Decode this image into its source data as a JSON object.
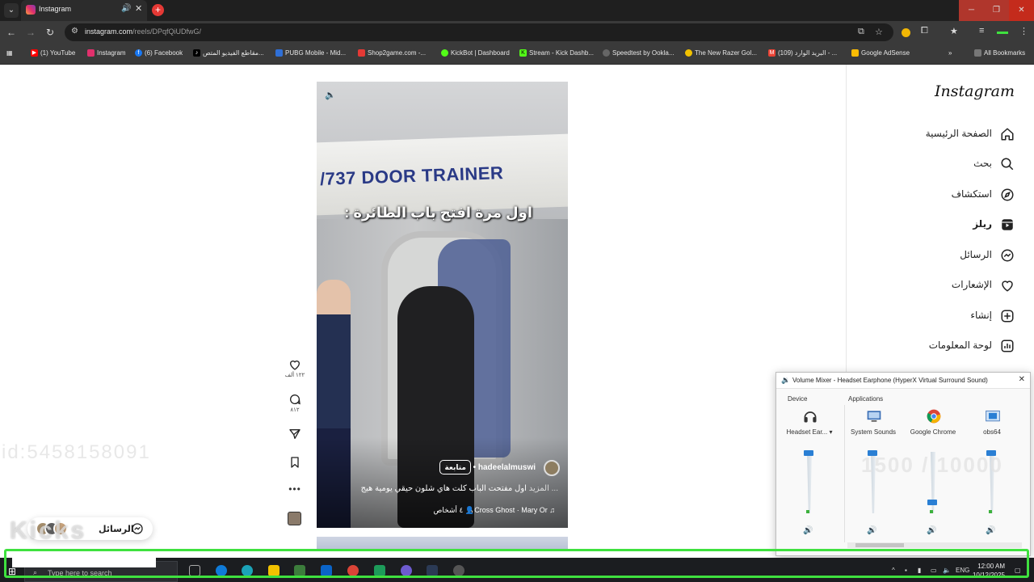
{
  "browser": {
    "tab_title": "Instagram",
    "url_host": "instagram.com",
    "url_path": "/reels/DPqfQiUDfwG/"
  },
  "bookmarks": [
    {
      "label": "(1) YouTube",
      "icon": "youtube-icon",
      "color": "#ff0000"
    },
    {
      "label": "Instagram",
      "icon": "instagram-icon",
      "color": "#e1306c"
    },
    {
      "label": "(6) Facebook",
      "icon": "facebook-icon",
      "color": "#1877f2"
    },
    {
      "label": "مقاطع الفيديو المتص...",
      "icon": "tiktok-icon",
      "color": "#000000"
    },
    {
      "label": "PUBG Mobile - Mid...",
      "icon": "pubg-icon",
      "color": "#2f6fd6"
    },
    {
      "label": "Shop2game.com -...",
      "icon": "shop-icon",
      "color": "#e53935"
    },
    {
      "label": "KickBot | Dashboard",
      "icon": "kickbot-icon",
      "color": "#53fc18"
    },
    {
      "label": "Stream - Kick Dashb...",
      "icon": "kick-icon",
      "color": "#53fc18"
    },
    {
      "label": "Speedtest by Ookla...",
      "icon": "speedtest-icon",
      "color": "#666666"
    },
    {
      "label": "The New Razer Gol...",
      "icon": "razer-icon",
      "color": "#f2c200"
    },
    {
      "label": "البريد الوارد (109) - ...",
      "icon": "gmail-icon",
      "color": "#ea4335"
    },
    {
      "label": "Google AdSense",
      "icon": "adsense-icon",
      "color": "#fbbc04"
    }
  ],
  "all_bookmarks": "All Bookmarks",
  "sidebar": {
    "logo": "Instagram",
    "items": [
      {
        "label": "الصفحة الرئيسية",
        "icon": "home-icon"
      },
      {
        "label": "بحث",
        "icon": "search-icon"
      },
      {
        "label": "استكشاف",
        "icon": "explore-icon"
      },
      {
        "label": "ريلز",
        "icon": "reels-icon",
        "active": true
      },
      {
        "label": "الرسائل",
        "icon": "messenger-icon"
      },
      {
        "label": "الإشعارات",
        "icon": "heart-icon"
      },
      {
        "label": "إنشاء",
        "icon": "create-icon"
      },
      {
        "label": "لوحة المعلومات",
        "icon": "dashboard-icon"
      }
    ]
  },
  "reel": {
    "sign_text": "/737 DOOR TRAINER",
    "overlay_text": "اول مرة افتح باب الطائرة :",
    "username": "hadeelalmuswi",
    "follow_label": "متابعة",
    "caption": "اول مفتحت الباب كلت هاي شلون حيقي يومية هيج",
    "caption_more": "... المزيد",
    "music": "A Cross  Ghost · Mary Or",
    "people": "٤ أشخاص"
  },
  "actions": {
    "likes": "١٢٢ ألف",
    "comments": "٨١٢"
  },
  "messages_pill": {
    "label": "الرسائل"
  },
  "overlays": {
    "id_text": "id:5458158091",
    "kicks_text": "Kicks",
    "count_text": "1500 / 10000"
  },
  "volume_mixer": {
    "title": "Volume Mixer - Headset Earphone (HyperX Virtual Surround Sound)",
    "device_header": "Device",
    "apps_header": "Applications",
    "channels": [
      {
        "label": "Headset Ear...",
        "icon": "headset-icon",
        "level": 1.0
      },
      {
        "label": "System Sounds",
        "icon": "system-sounds-icon",
        "level": 1.0
      },
      {
        "label": "Google Chrome",
        "icon": "chrome-icon",
        "level": 0.17
      },
      {
        "label": "obs64",
        "icon": "obs-icon",
        "level": 1.0
      }
    ]
  },
  "taskbar": {
    "search_placeholder": "Type here to search",
    "language": "ENG",
    "time": "12:00 AM",
    "date": "10/12/2025"
  }
}
